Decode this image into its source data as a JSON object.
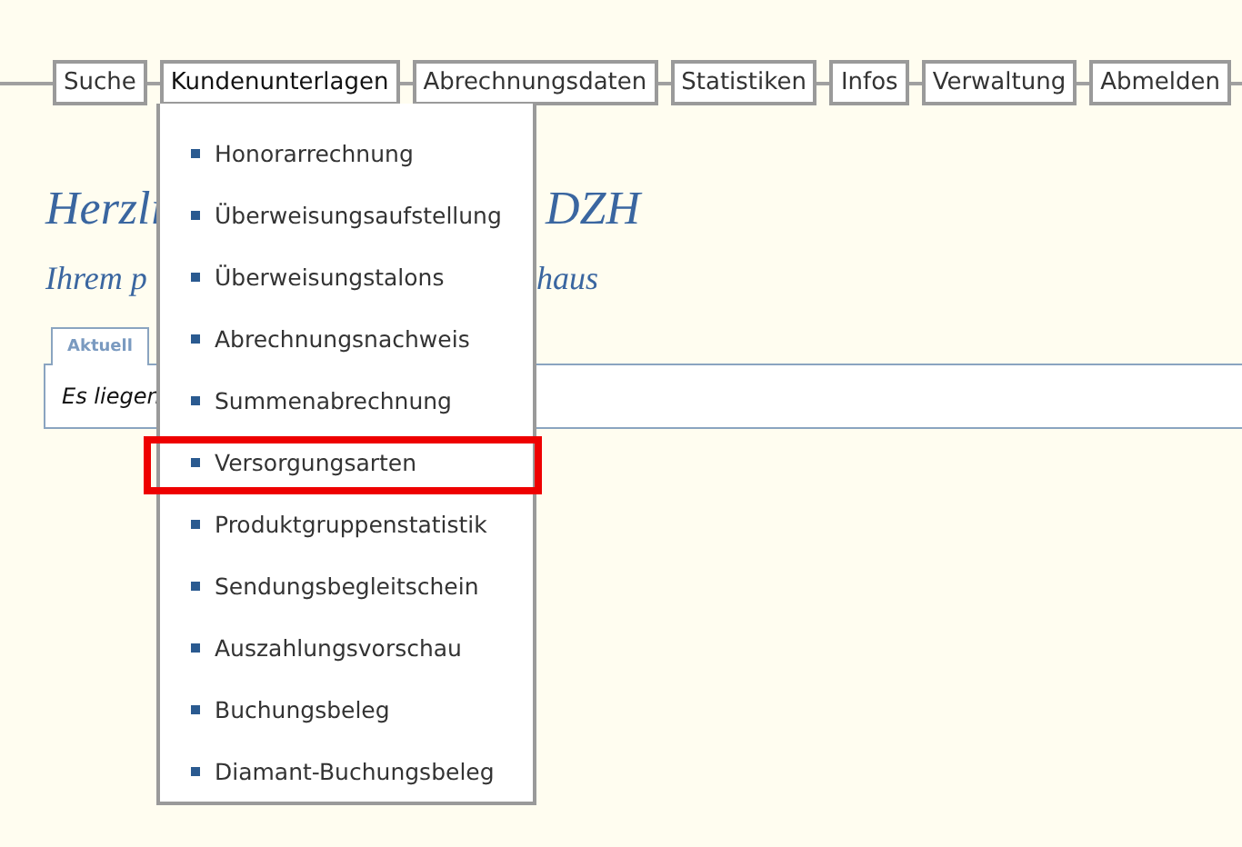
{
  "nav": [
    {
      "label": "Suche",
      "selected": false
    },
    {
      "label": "Kundenunterlagen",
      "selected": true
    },
    {
      "label": "Abrechnungsdaten",
      "selected": false
    },
    {
      "label": "Statistiken",
      "selected": false
    },
    {
      "label": "Infos",
      "selected": false
    },
    {
      "label": "Verwaltung",
      "selected": false
    },
    {
      "label": "Abmelden",
      "selected": false
    }
  ],
  "dropdown": [
    {
      "label": "Honorarrechnung",
      "highlighted": false
    },
    {
      "label": "Überweisungsaufstellung",
      "highlighted": false
    },
    {
      "label": "Überweisungstalons",
      "highlighted": false
    },
    {
      "label": "Abrechnungsnachweis",
      "highlighted": false
    },
    {
      "label": "Summenabrechnung",
      "highlighted": false
    },
    {
      "label": "Versorgungsarten",
      "highlighted": true
    },
    {
      "label": "Produktgruppenstatistik",
      "highlighted": false
    },
    {
      "label": "Sendungsbegleitschein",
      "highlighted": false
    },
    {
      "label": "Auszahlungsvorschau",
      "highlighted": false
    },
    {
      "label": "Buchungsbeleg",
      "highlighted": false
    },
    {
      "label": "Diamant-Buchungsbeleg",
      "highlighted": false
    }
  ],
  "greeting": [
    {
      "left": "Herzli",
      "right": "DZH"
    },
    {
      "left": "Ihrem p",
      "right": "haus"
    }
  ],
  "tabs": [
    {
      "label": "Aktuell",
      "selected": true
    }
  ],
  "panel": {
    "text": "Es liegen"
  }
}
